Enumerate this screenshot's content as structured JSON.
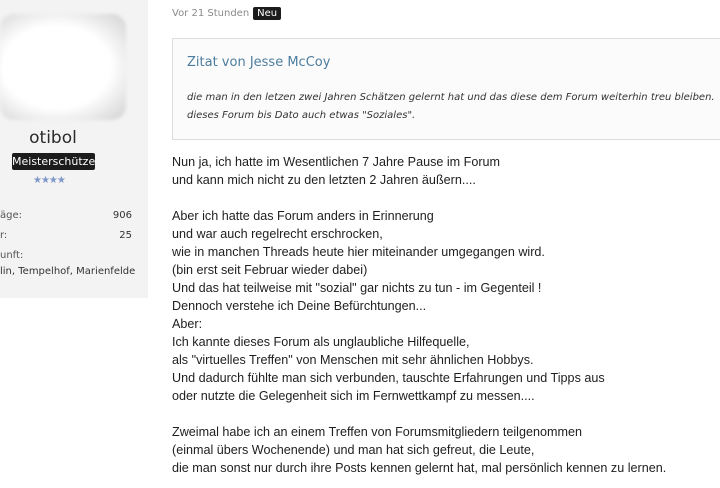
{
  "sidebar": {
    "username": "otibol",
    "rank": "Meisterschütze",
    "stars": "★★★★",
    "stats": [
      {
        "label": "äge:",
        "value": "906"
      },
      {
        "label": "r:",
        "value": "25"
      }
    ],
    "origin_label": "unft:",
    "location": "lin, Tempelhof, Marienfelde"
  },
  "post": {
    "time": "Vor 21 Stunden",
    "new_badge": "Neu",
    "quote": {
      "title": "Zitat von Jesse McCoy",
      "line1": "die man in den letzen zwei Jahren Schätzen gelernt hat und das diese dem Forum weiterhin treu bleiben.",
      "line2": "dieses Forum bis Dato auch etwas \"Soziales\"."
    },
    "lines": [
      "Nun ja, ich hatte im Wesentlichen 7 Jahre Pause im Forum",
      "und kann mich nicht zu den letzten 2 Jahren äußern....",
      "",
      "Aber ich hatte das Forum anders in Erinnerung",
      "und war auch regelrecht erschrocken,",
      "wie in manchen Threads heute hier miteinander umgegangen wird.",
      "(bin erst seit Februar wieder dabei)",
      "Und das hat teilweise mit \"sozial\" gar nichts zu tun - im Gegenteil !",
      "Dennoch verstehe ich Deine Befürchtungen...",
      "Aber:",
      "Ich kannte dieses Forum als unglaubliche Hilfequelle,",
      "als \"virtuelles Treffen\" von Menschen mit sehr ähnlichen Hobbys.",
      "Und dadurch fühlte man sich verbunden, tauschte Erfahrungen und Tipps aus",
      "oder nutzte die Gelegenheit sich im Fernwettkampf zu messen....",
      "",
      "Zweimal habe ich an einem Treffen von Forumsmitgliedern teilgenommen",
      "(einmal übers Wochenende) und man hat sich gefreut, die Leute,",
      "die man sonst nur durch ihre Posts kennen gelernt hat, mal persönlich kennen zu lernen."
    ]
  }
}
